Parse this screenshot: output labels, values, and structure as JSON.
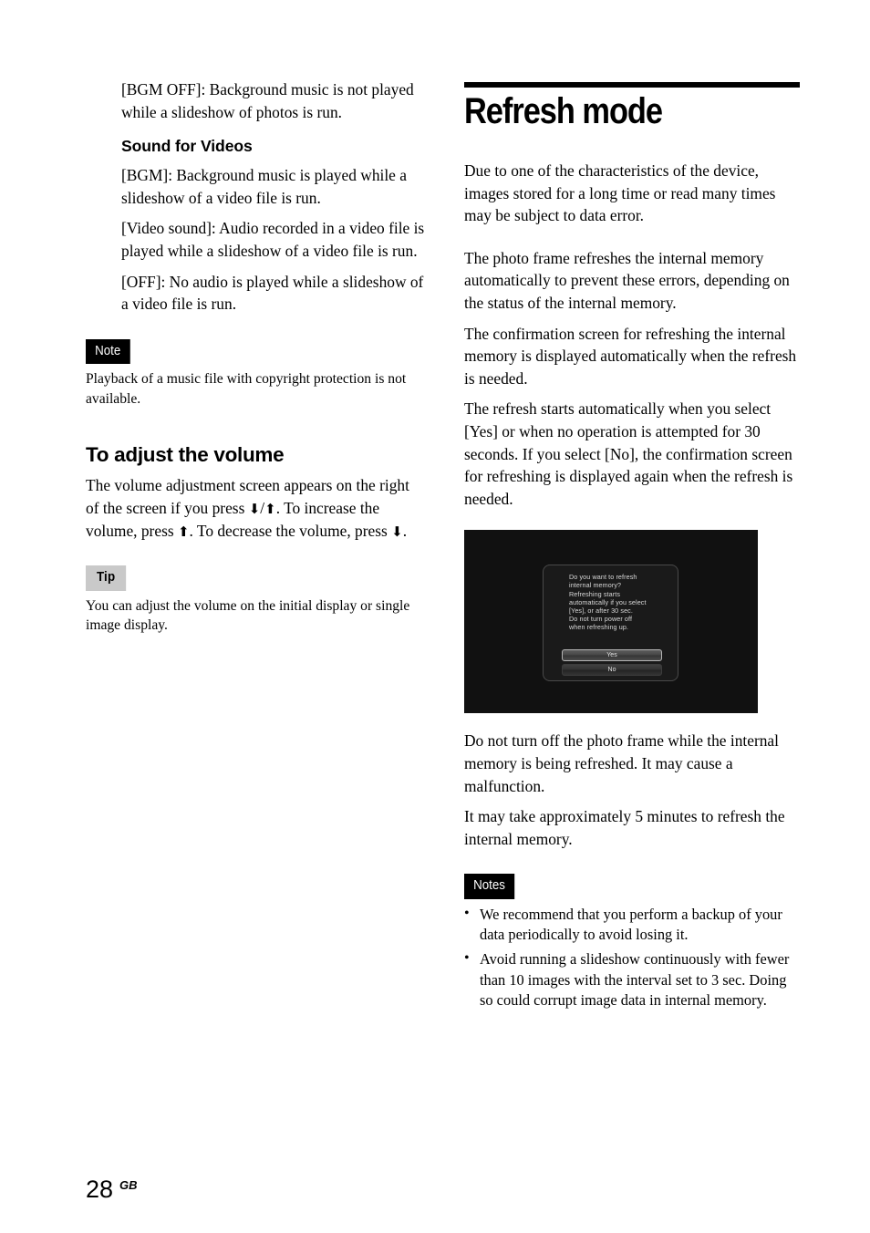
{
  "left_column": {
    "paragraphs_top": [
      "[BGM OFF]: Background music is not played while a slideshow of photos is run."
    ],
    "sound_heading": "Sound for Videos",
    "sound_paragraphs": [
      "[BGM]: Background music is played while a slideshow of a video file is run.",
      "[Video sound]: Audio recorded in a video file is played while a slideshow of a video file is run.",
      "[OFF]: No audio is played while a slideshow of a video file is run."
    ],
    "note_badge": "Note",
    "note_text": "Playback of a music file with copyright protection is not available.",
    "volume_heading": "To adjust the volume",
    "volume_text_1": "The volume adjustment screen appears on the right of the screen if you press ",
    "volume_arrow_down": "⬇",
    "volume_slash": "/",
    "volume_arrow_up": "⬆",
    "volume_text_2": ". To increase the volume, press ",
    "volume_text_3": ". To decrease the volume, press ",
    "volume_text_4": ".",
    "tip_badge": "Tip",
    "tip_text": "You can adjust the volume on the initial display or single image display."
  },
  "right_column": {
    "chapter_title": "Refresh mode",
    "paragraphs": [
      "Due to one of the characteristics of the device, images stored for a long time or read many times may be subject to data error.",
      "The photo frame refreshes the internal memory automatically to prevent these errors, depending on the status of the internal memory.",
      "The confirmation screen for refreshing the internal memory is displayed automatically when the refresh is needed.",
      "The refresh starts automatically when you select [Yes] or when no operation is attempted for 30 seconds. If you select [No], the confirmation screen for refreshing is displayed again when the refresh is needed."
    ],
    "figure": {
      "dialog_message": "Do you want to refresh\ninternal memory?\nRefreshing starts\nautomatically if you select\n[Yes], or after 30 sec.\nDo not turn power off\nwhen refreshing up.",
      "button_yes": "Yes",
      "button_no": "No"
    },
    "paragraphs_after": [
      "Do not turn off the photo frame while the internal memory is being refreshed. It may cause a malfunction.",
      "It may take approximately 5 minutes to refresh the internal memory."
    ],
    "notes_badge": "Notes",
    "notes_items": [
      "We recommend that you perform a backup of your data periodically to avoid losing it.",
      "Avoid running a slideshow continuously with fewer than 10 images with the interval set to 3 sec. Doing so could corrupt image data in internal memory."
    ],
    "bullet_glyph": "•"
  },
  "footer": {
    "page_number": "28",
    "region": "GB"
  }
}
